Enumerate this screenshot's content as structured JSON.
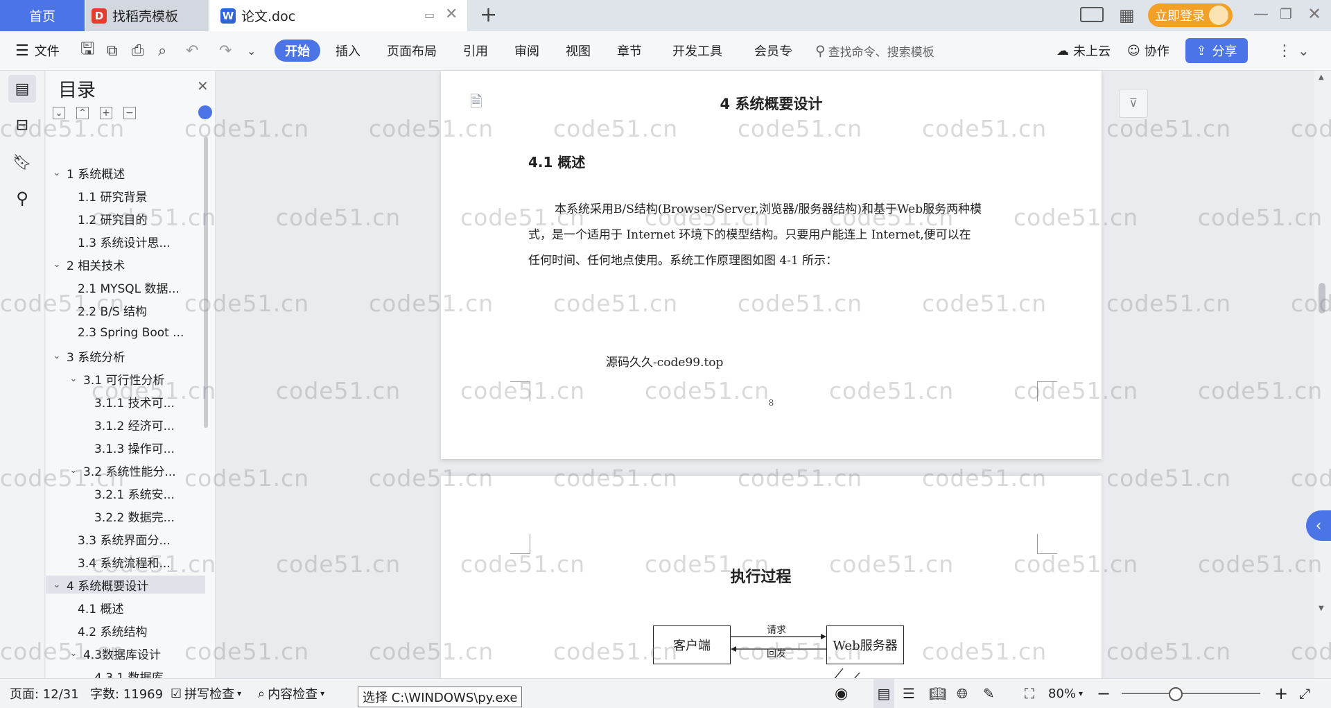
{
  "tabs": {
    "home": "首页",
    "template": "找稻壳模板",
    "doc": "论文.doc",
    "login": "立即登录"
  },
  "toolbar": {
    "file": "文件",
    "start": "开始",
    "insert": "插入",
    "layout": "页面布局",
    "reference": "引用",
    "review": "审阅",
    "view": "视图",
    "chapter": "章节",
    "devtools": "开发工具",
    "member": "会员专",
    "search_placeholder": "查找命令、搜索模板",
    "cloud": "未上云",
    "collab": "协作",
    "share": "分享"
  },
  "toc": {
    "title": "目录",
    "items": [
      {
        "label": "1 系统概述",
        "level": 1,
        "toggle": "expanded"
      },
      {
        "label": "1.1  研究背景",
        "level": 2,
        "toggle": "none"
      },
      {
        "label": "1.2 研究目的",
        "level": 2,
        "toggle": "none"
      },
      {
        "label": "1.3 系统设计思...",
        "level": 2,
        "toggle": "none"
      },
      {
        "label": "2 相关技术",
        "level": 1,
        "toggle": "expanded"
      },
      {
        "label": "2.1 MYSQL 数据...",
        "level": 2,
        "toggle": "none"
      },
      {
        "label": "2.2 B/S 结构",
        "level": 2,
        "toggle": "none"
      },
      {
        "label": "2.3 Spring Boot ...",
        "level": 2,
        "toggle": "none"
      },
      {
        "label": "3 系统分析",
        "level": 1,
        "toggle": "expanded"
      },
      {
        "label": "3.1 可行性分析",
        "level": 2,
        "toggle": "expanded"
      },
      {
        "label": "3.1.1 技术可...",
        "level": 3,
        "toggle": "none"
      },
      {
        "label": "3.1.2 经济可...",
        "level": 3,
        "toggle": "none"
      },
      {
        "label": "3.1.3 操作可...",
        "level": 3,
        "toggle": "none"
      },
      {
        "label": "3.2 系统性能分...",
        "level": 2,
        "toggle": "expanded"
      },
      {
        "label": "3.2.1  系统安...",
        "level": 3,
        "toggle": "none"
      },
      {
        "label": "3.2.2  数据完...",
        "level": 3,
        "toggle": "none"
      },
      {
        "label": "3.3 系统界面分...",
        "level": 2,
        "toggle": "none"
      },
      {
        "label": "3.4 系统流程和...",
        "level": 2,
        "toggle": "none"
      },
      {
        "label": "4 系统概要设计",
        "level": 1,
        "toggle": "expanded",
        "selected": true
      },
      {
        "label": "4.1 概述",
        "level": 2,
        "toggle": "none"
      },
      {
        "label": "4.2 系统结构",
        "level": 2,
        "toggle": "none"
      },
      {
        "label": "4.3数据库设计",
        "level": 2,
        "toggle": "expanded"
      },
      {
        "label": "4.3.1 数据库",
        "level": 3,
        "toggle": "none"
      }
    ]
  },
  "document": {
    "chapter_title": "4 系统概要设计",
    "section_title": "4.1 概述",
    "paragraph_lines": [
      "本系统采用B/S结构(Browser/Server,浏览器/服务器结构)和基于Web服务两种模",
      "式，是一个适用于 Internet 环境下的模型结构。只要用户能连上 Internet,便可以在",
      "任何时间、任何地点使用。系统工作原理图如图 4-1 所示："
    ],
    "source_note": "源码久久-code99.top",
    "page_number": "8",
    "diagram_title": "执行过程",
    "diagram": {
      "client": "客户端",
      "server": "Web服务器",
      "request": "请求",
      "response": "回发"
    }
  },
  "watermark": "code51.cn",
  "statusbar": {
    "page": "页面: 12/31",
    "words": "字数: 11969",
    "spell": "拼写检查",
    "content": "内容检查",
    "zoom": "80%",
    "tooltip": "选择 C:\\WINDOWS\\py.exe"
  },
  "colors": {
    "accent": "#4b74e6",
    "login": "#f2a126"
  }
}
